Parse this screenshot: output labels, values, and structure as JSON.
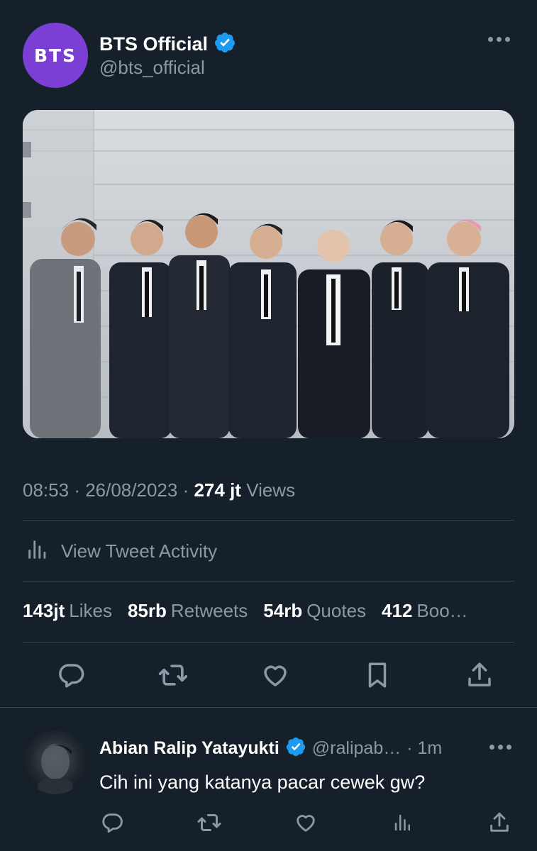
{
  "tweet": {
    "avatar_text": "BTS",
    "display_name": "BTS Official",
    "handle": "@bts_official",
    "time": "08:53",
    "date": "26/08/2023",
    "views_count": "274 jt",
    "views_label": "Views",
    "view_activity_label": "View Tweet Activity",
    "stats": {
      "likes_count": "143jt",
      "likes_label": "Likes",
      "retweets_count": "85rb",
      "retweets_label": "Retweets",
      "quotes_count": "54rb",
      "quotes_label": "Quotes",
      "bookmarks_count": "412",
      "bookmarks_label": "Boo…"
    }
  },
  "reply": {
    "display_name": "Abian Ralip Yatayukti",
    "handle": "@ralipab…",
    "time": "· 1m",
    "text": "Cih ini yang katanya pacar cewek gw?"
  },
  "colors": {
    "background": "#15202b",
    "verified": "#1d9bf0",
    "muted": "#8b98a5",
    "avatar": "#7b3fd6"
  }
}
